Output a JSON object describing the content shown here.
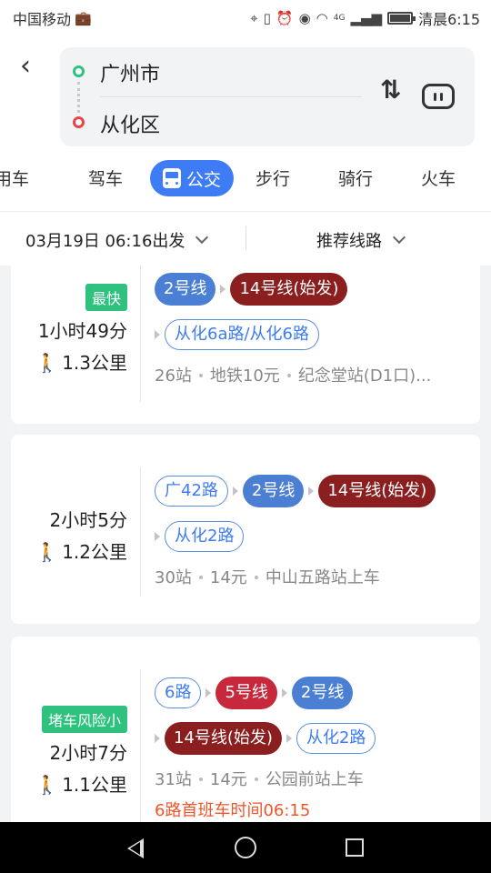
{
  "status_bar": {
    "carrier": "中国移动",
    "time": "清晨6:15",
    "network": "4G",
    "icons": [
      "briefcase-icon",
      "location-icon",
      "vibrate-icon",
      "alarm-icon",
      "eye-icon",
      "wifi-icon",
      "signal-icon",
      "battery-icon"
    ]
  },
  "route": {
    "from": "广州市",
    "to": "从化区"
  },
  "tabs": [
    {
      "label": "用车"
    },
    {
      "label": "驾车"
    },
    {
      "label": "公交",
      "active": true
    },
    {
      "label": "步行"
    },
    {
      "label": "骑行"
    },
    {
      "label": "火车"
    }
  ],
  "filters": {
    "depart": "03月19日 06:16出发",
    "sort": "推荐线路"
  },
  "routes": [
    {
      "badge": "最快",
      "duration": "1小时49分",
      "walk": "1.3公里",
      "lines": [
        [
          {
            "name": "2号线",
            "style": "blue"
          },
          {
            "name": "14号线(始发)",
            "style": "maroon"
          }
        ],
        [
          {
            "name": "从化6a路/从化6路",
            "style": "outline"
          }
        ]
      ],
      "stops": "26站",
      "fare": "地铁10元",
      "board": "纪念堂站(D1口)..."
    },
    {
      "badge": "",
      "duration": "2小时5分",
      "walk": "1.2公里",
      "lines": [
        [
          {
            "name": "广42路",
            "style": "outline"
          },
          {
            "name": "2号线",
            "style": "blue"
          },
          {
            "name": "14号线(始发)",
            "style": "maroon"
          }
        ],
        [
          {
            "name": "从化2路",
            "style": "outline"
          }
        ]
      ],
      "stops": "30站",
      "fare": "14元",
      "board": "中山五路站上车"
    },
    {
      "badge": "堵车风险小",
      "duration": "2小时7分",
      "walk": "1.1公里",
      "lines": [
        [
          {
            "name": "6路",
            "style": "outline"
          },
          {
            "name": "5号线",
            "style": "red"
          },
          {
            "name": "2号线",
            "style": "blue"
          }
        ],
        [
          {
            "name": "14号线(始发)",
            "style": "maroon"
          },
          {
            "name": "从化2路",
            "style": "outline"
          }
        ]
      ],
      "stops": "31站",
      "fare": "14元",
      "board": "公园前站上车",
      "warning": "6路首班车时间06:15"
    }
  ],
  "colors": {
    "accent": "#3d7cf5",
    "line_2": "#4a7fd4",
    "line_14": "#8b1e1e",
    "line_5": "#c8283c",
    "badge_green": "#2ec27e",
    "warning": "#f0552a"
  }
}
